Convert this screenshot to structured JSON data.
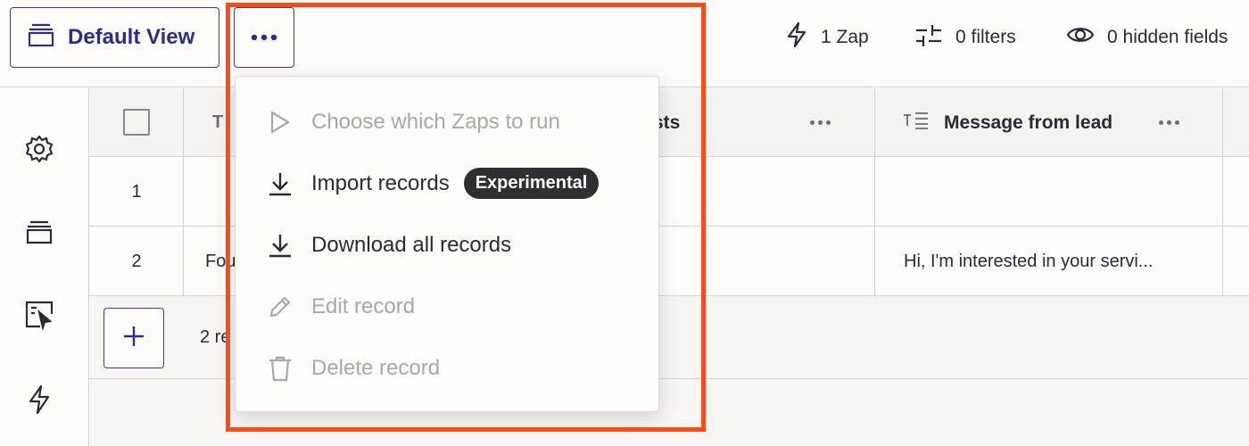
{
  "toolbar": {
    "view_label": "Default View",
    "zap_count": "1 Zap",
    "filters": "0 filters",
    "hidden_fields": "0 hidden fields"
  },
  "table": {
    "columns": [
      {
        "label": "T",
        "truncated_label": "",
        "icon": "text-icon"
      },
      {
        "label": "sts",
        "icon": ""
      },
      {
        "label": "Message from lead",
        "icon": "long-text-icon"
      }
    ],
    "rows": [
      {
        "num": "1",
        "col1": "",
        "message": ""
      },
      {
        "num": "2",
        "col1": "Fou",
        "message": "Hi, I'm interested in your servi..."
      }
    ],
    "footer_count": "2 re"
  },
  "menu": {
    "items": [
      {
        "label": "Choose which Zaps to run",
        "icon": "play-icon",
        "enabled": false
      },
      {
        "label": "Import records",
        "icon": "download-icon",
        "enabled": true,
        "badge": "Experimental"
      },
      {
        "label": "Download all records",
        "icon": "download-icon",
        "enabled": true
      },
      {
        "label": "Edit record",
        "icon": "pencil-icon",
        "enabled": false
      },
      {
        "label": "Delete record",
        "icon": "trash-icon",
        "enabled": false
      }
    ]
  },
  "colors": {
    "accent": "#2e2c8c",
    "highlight": "#ff4a1c",
    "badge_bg": "#2f2f31",
    "disabled_text": "#a9a7ad"
  }
}
